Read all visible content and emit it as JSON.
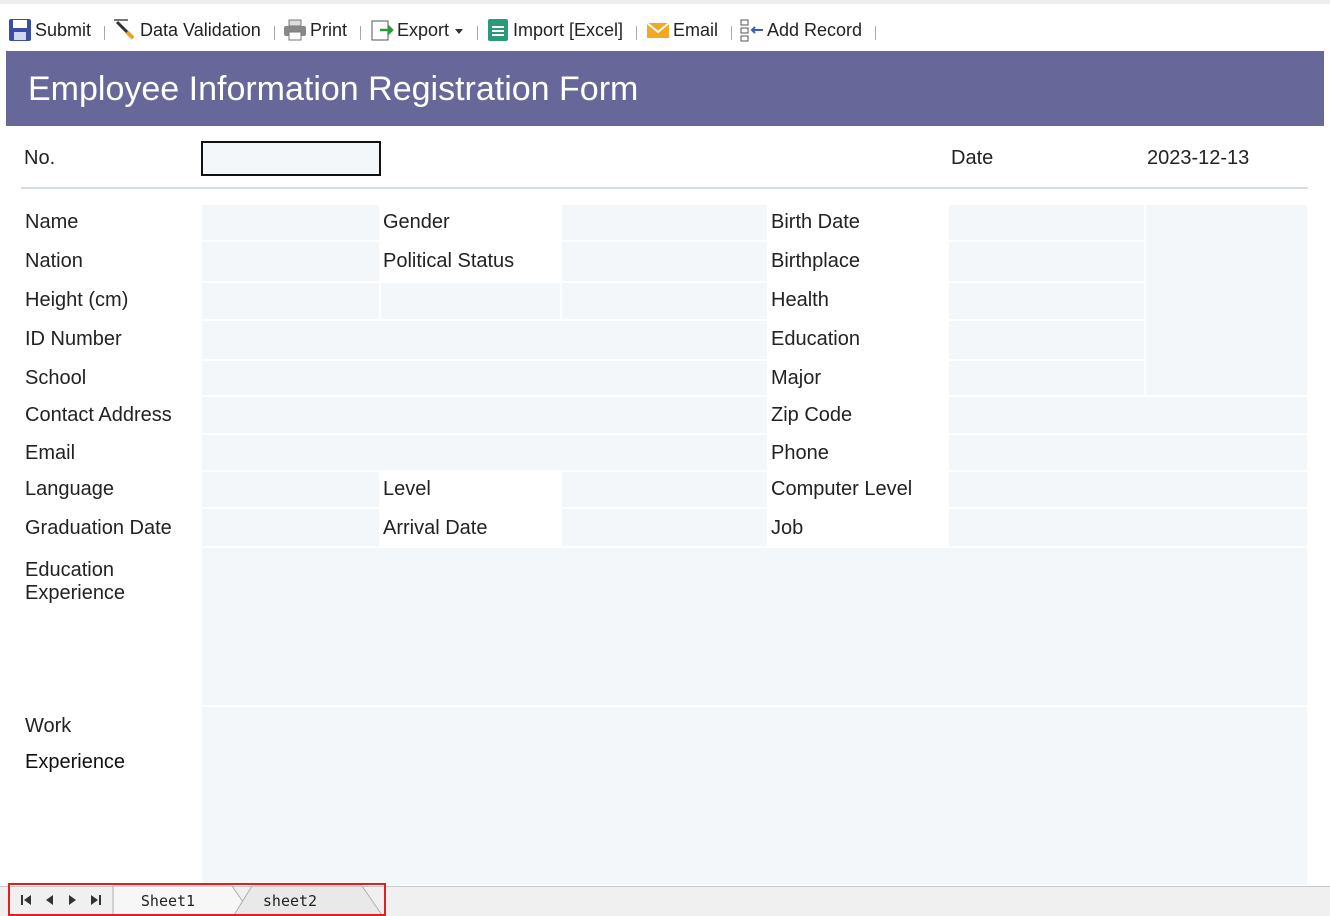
{
  "toolbar": {
    "submit": "Submit",
    "data_validation": "Data Validation",
    "print": "Print",
    "export": "Export",
    "import_excel": "Import [Excel]",
    "email": "Email",
    "add_record": "Add Record"
  },
  "form": {
    "title": "Employee Information Registration Form",
    "no_label": "No.",
    "no_value": "",
    "date_label": "Date",
    "date_value": "2023-12-13",
    "labels": {
      "name": "Name",
      "gender": "Gender",
      "birth_date": "Birth Date",
      "nation": "Nation",
      "political_status": "Political Status",
      "birthplace": "Birthplace",
      "height": "Height (cm)",
      "health": "Health",
      "id_number": "ID Number",
      "education": "Education",
      "school": "School",
      "major": "Major",
      "contact_address": "Contact Address",
      "zip_code": "Zip Code",
      "email": "Email",
      "phone": "Phone",
      "language": "Language",
      "level": "Level",
      "computer_level": "Computer Level",
      "graduation_date": "Graduation Date",
      "arrival_date": "Arrival Date",
      "job": "Job",
      "education_experience_1": "Education",
      "education_experience_2": "Experience",
      "work_experience_1": "Work",
      "work_experience_2": "Experience"
    }
  },
  "sheets": {
    "tabs": [
      "Sheet1",
      "sheet2"
    ]
  },
  "colors": {
    "banner": "#676799",
    "cell": "#f4f7fa",
    "tab_highlight": "#e02020"
  }
}
